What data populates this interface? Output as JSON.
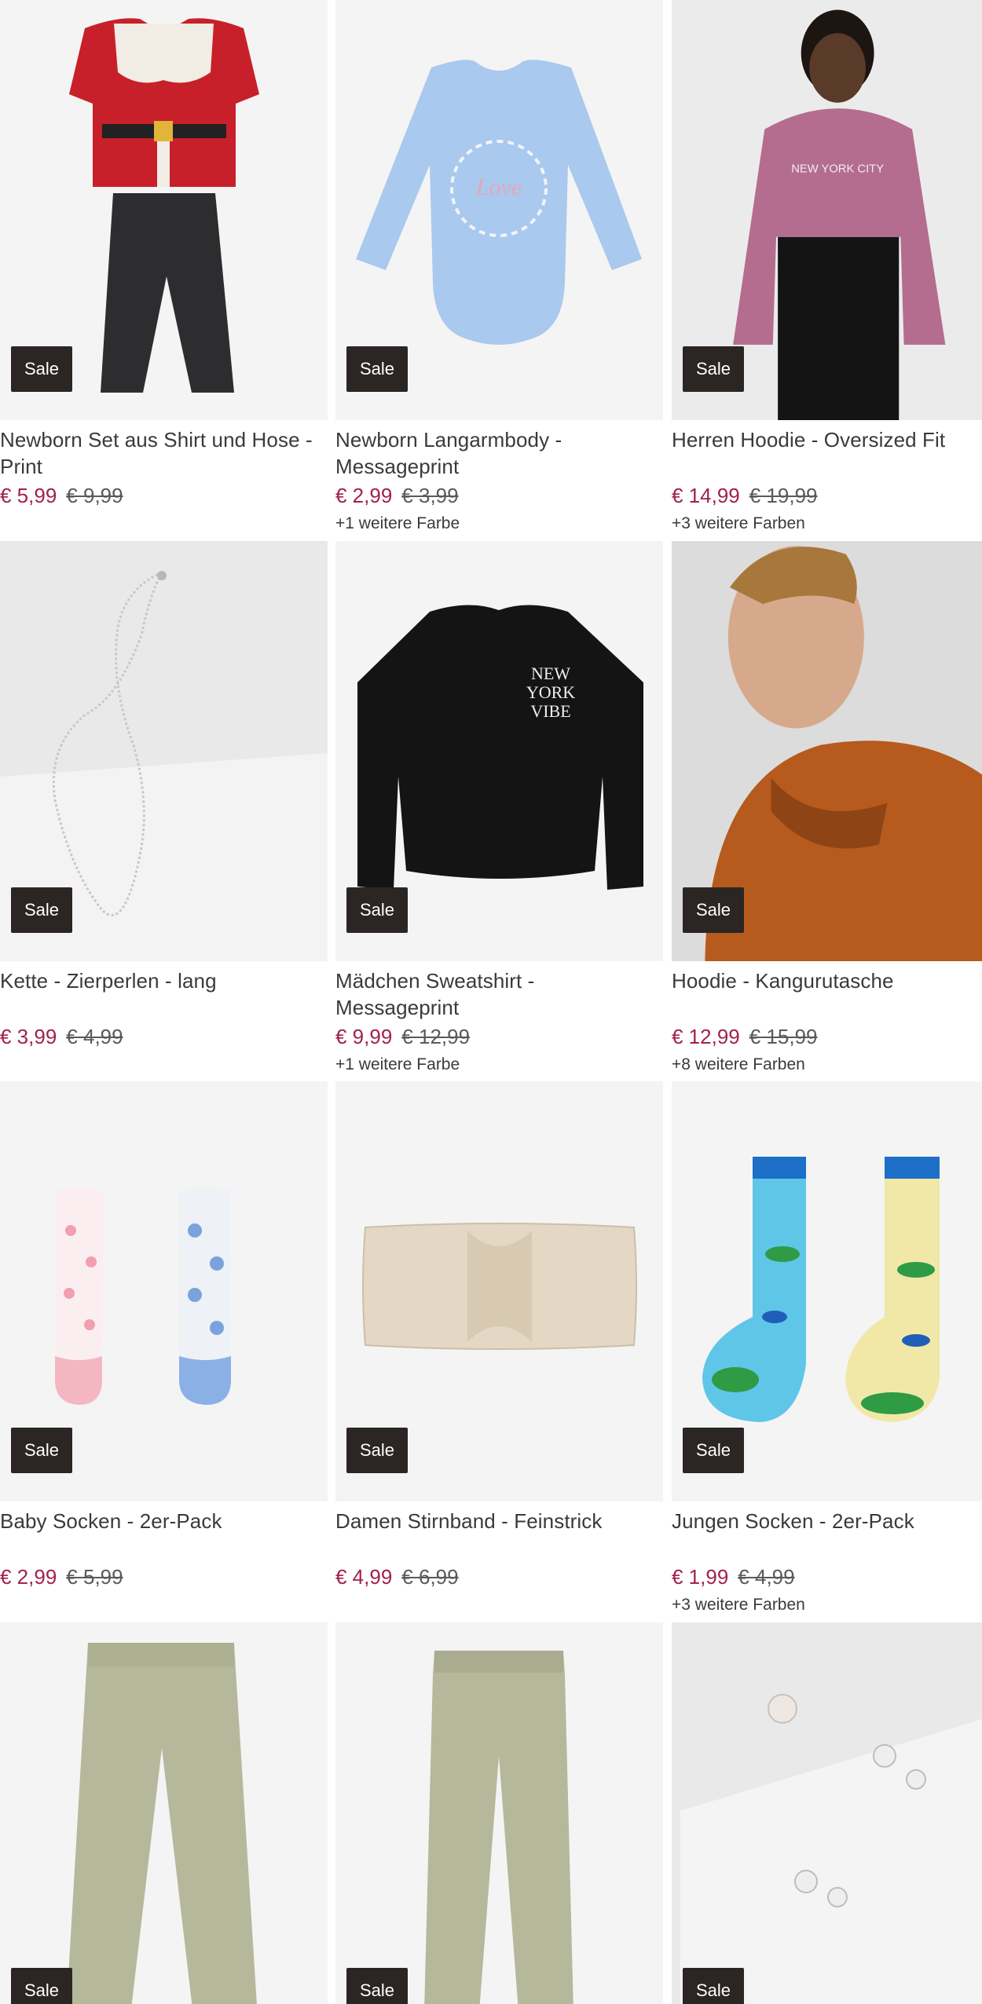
{
  "products": [
    {
      "title": "Newborn Set aus Shirt und Hose - Print",
      "price": "€ 5,99",
      "old_price": "€ 9,99",
      "colors": "",
      "badge": "Sale",
      "icon": "santa-set-image"
    },
    {
      "title": "Newborn Langarmbody - Messageprint",
      "price": "€ 2,99",
      "old_price": "€ 3,99",
      "colors": "+1 weitere Farbe",
      "badge": "Sale",
      "icon": "baby-body-image"
    },
    {
      "title": "Herren Hoodie - Oversized Fit",
      "price": "€ 14,99",
      "old_price": "€ 19,99",
      "colors": "+3 weitere Farben",
      "badge": "Sale",
      "icon": "hoodie-model-image"
    },
    {
      "title": "Kette - Zierperlen - lang",
      "price": "€ 3,99",
      "old_price": "€ 4,99",
      "colors": "",
      "badge": "Sale",
      "icon": "necklace-image"
    },
    {
      "title": "Mädchen Sweatshirt - Messageprint",
      "price": "€ 9,99",
      "old_price": "€ 12,99",
      "colors": "+1 weitere Farbe",
      "badge": "Sale",
      "icon": "sweatshirt-image"
    },
    {
      "title": "Hoodie - Kangurutasche",
      "price": "€ 12,99",
      "old_price": "€ 15,99",
      "colors": "+8 weitere Farben",
      "badge": "Sale",
      "icon": "hoodie-orange-image"
    },
    {
      "title": "Baby Socken - 2er-Pack",
      "price": "€ 2,99",
      "old_price": "€ 5,99",
      "colors": "",
      "badge": "Sale",
      "icon": "baby-socks-image"
    },
    {
      "title": "Damen Stirnband - Feinstrick",
      "price": "€ 4,99",
      "old_price": "€ 6,99",
      "colors": "",
      "badge": "Sale",
      "icon": "headband-image"
    },
    {
      "title": "Jungen Socken - 2er-Pack",
      "price": "€ 1,99",
      "old_price": "€ 4,99",
      "colors": "+3 weitere Farben",
      "badge": "Sale",
      "icon": "kids-socks-image"
    },
    {
      "title": "",
      "price": "",
      "old_price": "",
      "colors": "",
      "badge": "Sale",
      "icon": "leggings-image"
    },
    {
      "title": "",
      "price": "",
      "old_price": "",
      "colors": "",
      "badge": "Sale",
      "icon": "jeggings-image"
    },
    {
      "title": "",
      "price": "",
      "old_price": "",
      "colors": "",
      "badge": "Sale",
      "icon": "earrings-image"
    }
  ],
  "colors": {
    "sale_price": "#a2214f",
    "badge_bg": "#2b2523",
    "image_bg": "#f4f4f4"
  }
}
